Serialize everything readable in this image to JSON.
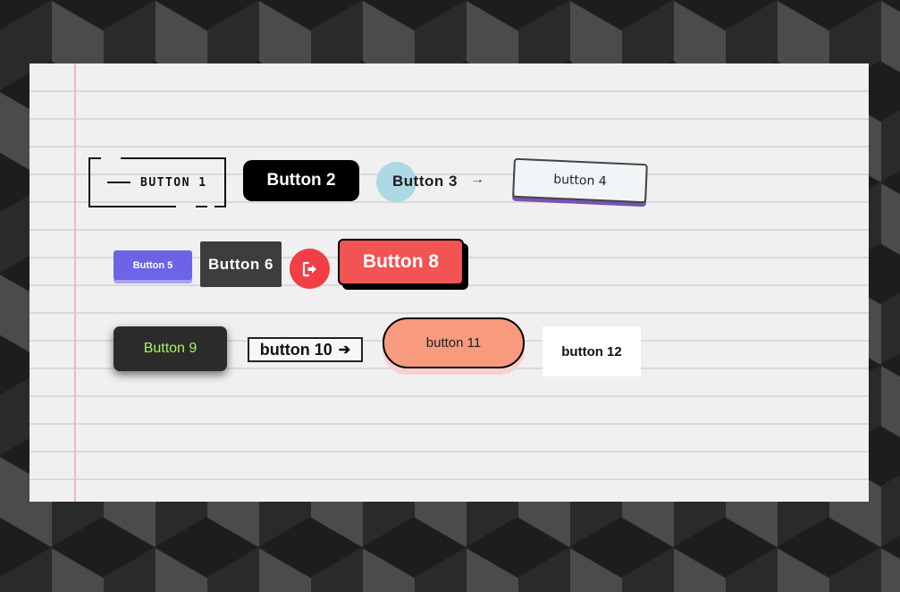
{
  "buttons": {
    "b1": {
      "label": "BUTTON 1"
    },
    "b2": {
      "label": "Button 2"
    },
    "b3": {
      "label": "Button 3",
      "arrow": "→"
    },
    "b4": {
      "label": "button 4"
    },
    "b5": {
      "label": "Button 5"
    },
    "b6": {
      "label": "Button 6"
    },
    "b7": {
      "icon": "sign-out-icon"
    },
    "b8": {
      "label": "Button 8"
    },
    "b9": {
      "label": "Button 9"
    },
    "b10": {
      "label": "button 10",
      "arrow": "➔"
    },
    "b11": {
      "label": "button 11"
    },
    "b12": {
      "label": "button 12"
    }
  },
  "colors": {
    "paper": "#f0f0f0",
    "paper_lines": "#d9d9d9",
    "margin_line": "#f3b7b7",
    "b2_bg": "#000000",
    "b3_circle": "#add8e6",
    "b4_shadow": "#7653b4",
    "b5_bg": "#6c63e6",
    "b6_bg": "#3d3d3d",
    "b7_bg": "#f23f45",
    "b8_bg": "#f25353",
    "b9_bg": "#2b2b2b",
    "b9_text": "#a8f65a",
    "b11_bg": "#f79a7e"
  }
}
